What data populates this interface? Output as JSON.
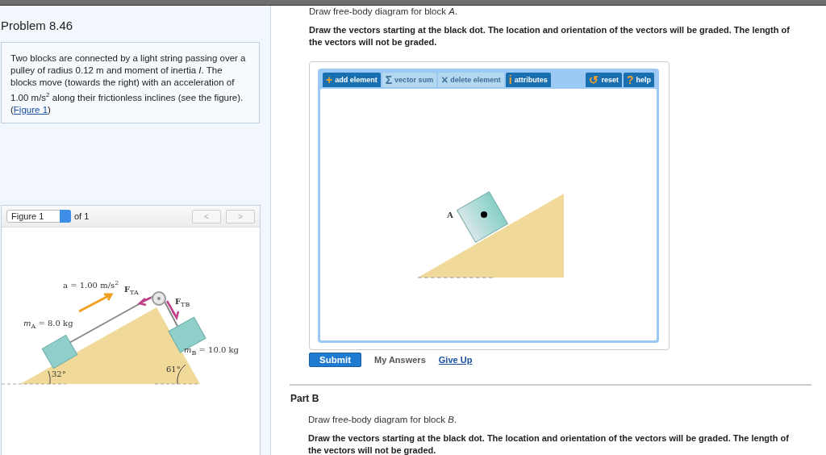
{
  "problem": {
    "title": "Problem 8.46",
    "statement_before": "Two blocks are connected by a light string passing over a pulley of radius 0.12 m and moment of inertia *I*. The blocks move (towards the right) with an acceleration of 1.00 m/s$^{2}$ along their frictionless inclines (see the figure). (",
    "figure_link": "Figure 1",
    "statement_after": ")"
  },
  "figure": {
    "selector": "Figure 1",
    "count_label": "of 1",
    "prev": "<",
    "next": ">",
    "labels": [
      "a = 1.00 m/s$^{2}$",
      "**F**$_{TA}$",
      "**F**$_{TB}$",
      "*m*$_{A}$ = 8.0 kg",
      "*m*$_{B}$ = 10.0 kg",
      "32°",
      "61°"
    ]
  },
  "part_a": {
    "prompt": "Draw free-body diagram for block *A*.",
    "instructions": "Draw the vectors starting at the black dot. The location and orientation of the vectors will be graded. The length of the vectors will not be graded.",
    "toolbar": [
      {
        "icon": "+",
        "label": "add element",
        "disabled": false
      },
      {
        "icon": "Σ",
        "label": "vector sum",
        "disabled": true
      },
      {
        "icon": "×",
        "label": "delete element",
        "disabled": true
      },
      {
        "icon": "i",
        "label": "attributes",
        "disabled": false
      },
      {
        "icon": "↺",
        "label": "reset",
        "disabled": false
      },
      {
        "icon": "?",
        "label": "help",
        "disabled": false
      }
    ],
    "canvas": {
      "block_label": "A"
    },
    "submit": "Submit",
    "my_answers": "My Answers",
    "give_up": "Give Up"
  },
  "part_b": {
    "title": "Part B",
    "prompt": "Draw free-body diagram for block *B*.",
    "instructions": "Draw the vectors starting at the black dot. The location and orientation of the vectors will be graded. The length of the vectors will not be graded."
  }
}
